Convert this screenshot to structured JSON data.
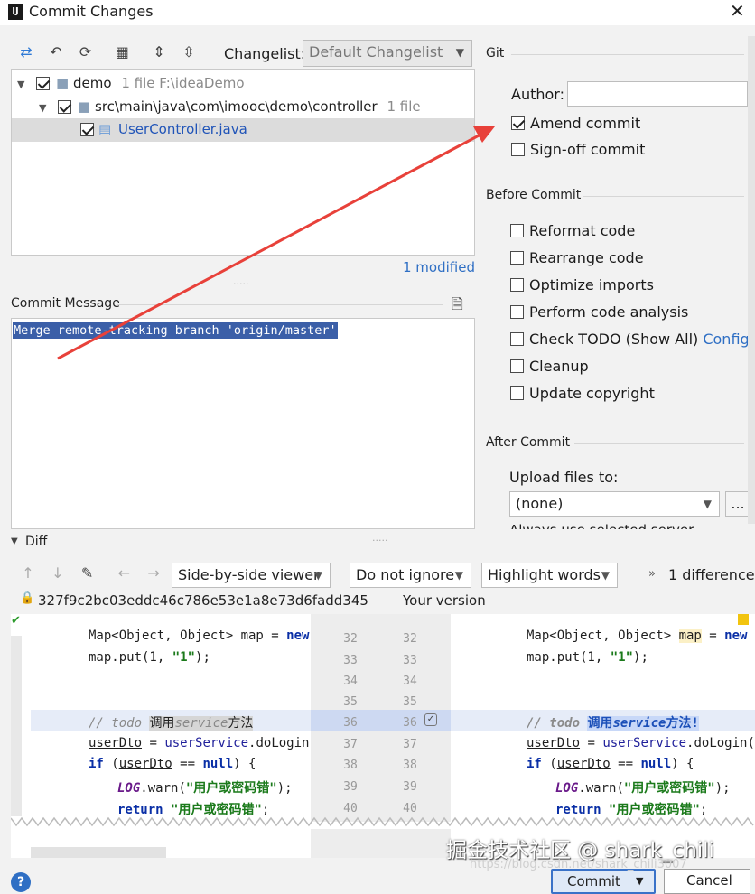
{
  "window": {
    "title": "Commit Changes",
    "app_icon": "IJ"
  },
  "toolbar": {
    "changelist_label": "Changelist:",
    "changelist_value": "Default Changelist"
  },
  "tree": {
    "root": {
      "name": "demo",
      "meta": "1 file  F:\\ideaDemo"
    },
    "pkg": {
      "name": "src\\main\\java\\com\\imooc\\demo\\controller",
      "meta": "1 file"
    },
    "file": {
      "name": "UserController.java"
    },
    "modified": "1 modified"
  },
  "commit_message": {
    "label": "Commit Message",
    "text": "Merge remote-tracking branch 'origin/master'"
  },
  "git": {
    "section": "Git",
    "author_label": "Author:",
    "author_value": "",
    "amend": "Amend commit",
    "signoff": "Sign-off commit"
  },
  "before_commit": {
    "section": "Before Commit",
    "options": [
      "Reformat code",
      "Rearrange code",
      "Optimize imports",
      "Perform code analysis",
      "Check TODO (Show All)",
      "Cleanup",
      "Update copyright"
    ],
    "configure": "Configure"
  },
  "after_commit": {
    "section": "After Commit",
    "upload_label": "Upload files to:",
    "upload_value": "(none)",
    "browse": "...",
    "always_use": "Always use selected server"
  },
  "diff": {
    "section": "Diff",
    "viewer": "Side-by-side viewer",
    "ignore": "Do not ignore",
    "highlight": "Highlight words",
    "differences": "1 difference",
    "left_rev": "327f9c2bc03eddc46c786e53e1a8e73d6fadd345",
    "right_rev": "Your version",
    "line_numbers": [
      "32",
      "33",
      "34",
      "35",
      "36",
      "37",
      "38",
      "39",
      "40"
    ]
  },
  "buttons": {
    "help": "?",
    "commit": "Commit",
    "cancel": "Cancel"
  },
  "watermark": {
    "text": "掘金技术社区 @ shark_chili",
    "url": "https://blog.csdn.net/shark_chili3007"
  }
}
